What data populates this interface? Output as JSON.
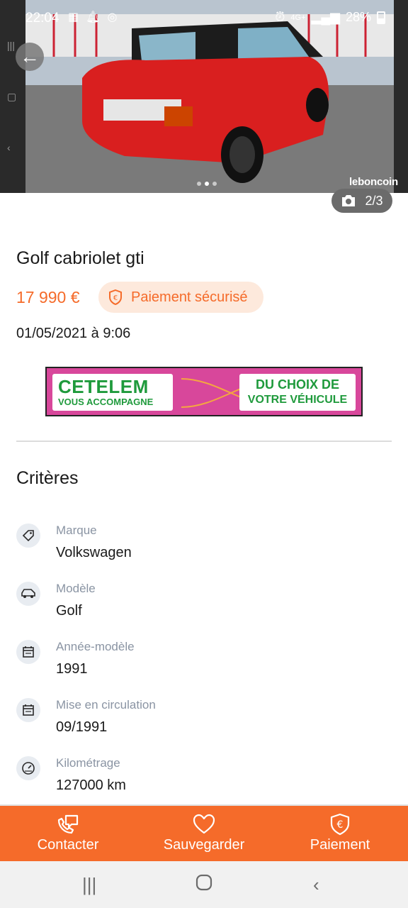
{
  "status_bar": {
    "time": "22:04",
    "network": "4G+",
    "battery": "28%"
  },
  "gallery": {
    "watermark": "leboncoin",
    "counter": "2/3",
    "dots": 3,
    "active_dot": 1
  },
  "listing": {
    "title": "Golf cabriolet gti",
    "price": "17 990 €",
    "secure_payment": "Paiement sécurisé",
    "date": "01/05/2021 à 9:06"
  },
  "ad": {
    "brand": "CETELEM",
    "brand_sub": "VOUS ACCOMPAGNE",
    "line1": "DU CHOIX DE",
    "line2": "VOTRE VÉHICULE"
  },
  "criteria": {
    "title": "Critères",
    "items": [
      {
        "label": "Marque",
        "value": "Volkswagen",
        "icon": "tag-icon"
      },
      {
        "label": "Modèle",
        "value": "Golf",
        "icon": "car-icon"
      },
      {
        "label": "Année-modèle",
        "value": "1991",
        "icon": "calendar-icon"
      },
      {
        "label": "Mise en circulation",
        "value": "09/1991",
        "icon": "calendar-icon"
      },
      {
        "label": "Kilométrage",
        "value": "127000 km",
        "icon": "gauge-icon"
      }
    ]
  },
  "actions": {
    "contact": "Contacter",
    "save": "Sauvegarder",
    "payment": "Paiement"
  },
  "colors": {
    "accent": "#f56b2a",
    "accent_light": "#fde9dc",
    "ad_pink": "#d8479b",
    "ad_green": "#1f9a3c"
  }
}
